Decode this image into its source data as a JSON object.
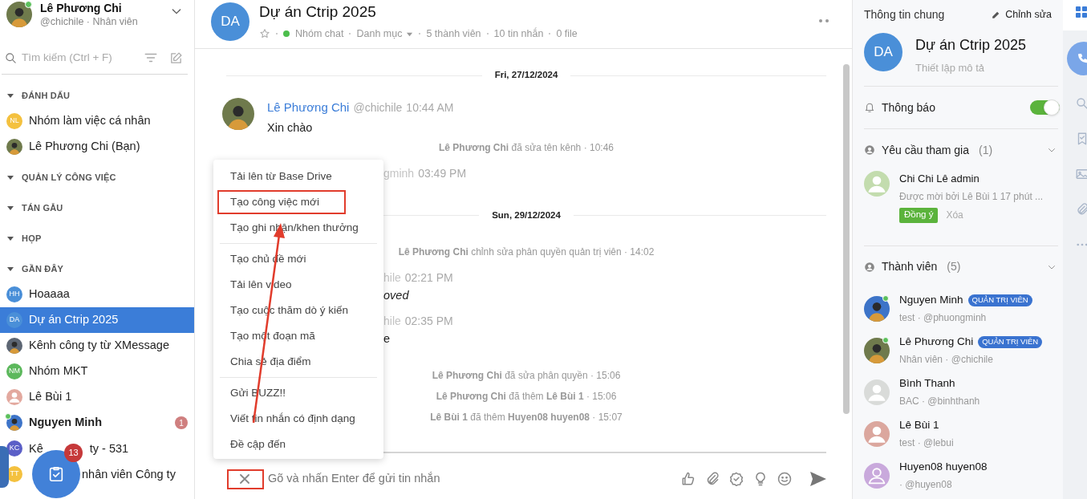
{
  "user": {
    "name": "Lê Phương Chi",
    "subtitle": "@chichile · Nhân viên",
    "online": true
  },
  "search": {
    "placeholder": "Tìm kiếm (Ctrl + F)"
  },
  "sections": [
    {
      "title": "ĐÁNH DẤU",
      "items": [
        {
          "label": "Nhóm làm việc cá nhân",
          "avatar": {
            "kind": "initials",
            "initials": "NL",
            "color": "#f4c13f"
          },
          "selected": false,
          "online": false,
          "unread": false
        },
        {
          "label": "Lê Phương Chi (Bạn)",
          "avatar": {
            "kind": "photo",
            "color": "#6f7a4c"
          },
          "selected": false,
          "online": false,
          "unread": false
        }
      ]
    },
    {
      "title": "QUẢN LÝ CÔNG VIỆC"
    },
    {
      "title": "TÁN GẪU"
    },
    {
      "title": "HỌP"
    },
    {
      "title": "GẦN ĐÂY",
      "items": [
        {
          "label": "Hoaaaa",
          "avatar": {
            "kind": "initials",
            "initials": "HH",
            "color": "#4a8fd8"
          },
          "selected": false,
          "online": false,
          "unread": false
        },
        {
          "label": "Dự án Ctrip 2025",
          "avatar": {
            "kind": "initials",
            "initials": "DA",
            "color": "#4a8fd8"
          },
          "selected": true,
          "online": false,
          "unread": false
        },
        {
          "label": "Kênh công ty từ XMessage",
          "avatar": {
            "kind": "photo",
            "color": "#5d6673"
          },
          "selected": false,
          "online": false,
          "unread": false
        },
        {
          "label": "Nhóm MKT",
          "avatar": {
            "kind": "initials",
            "initials": "NM",
            "color": "#5cb85c"
          },
          "selected": false,
          "online": false,
          "unread": false
        },
        {
          "label": "Lê Bùi 1",
          "avatar": {
            "kind": "person",
            "color": "#e3a99f"
          },
          "selected": false,
          "online": false,
          "unread": false
        },
        {
          "label": "Nguyen Minh",
          "avatar": {
            "kind": "photo",
            "color": "#3d74c8"
          },
          "selected": false,
          "online": true,
          "unread": true,
          "badge": "1"
        },
        {
          "label": "Kê",
          "label_tail": "ty - 531",
          "avatar": {
            "kind": "initials",
            "initials": "KC",
            "color": "#5b5fc7"
          },
          "selected": false,
          "online": false,
          "unread": false
        },
        {
          "label": "nhân viên Công ty",
          "kind": "covered",
          "avatar": {
            "kind": "initials",
            "initials": "TT",
            "color": "#f4c13f"
          },
          "selected": false,
          "online": false,
          "unread": false
        }
      ]
    }
  ],
  "fab": {
    "badge": "13"
  },
  "channel": {
    "initials": "DA",
    "title": "Dự án Ctrip 2025",
    "starred": false,
    "type": "Nhóm chat",
    "category": "Danh mục",
    "members": "5 thành viên",
    "messages": "10 tin nhắn",
    "files": "0 file"
  },
  "timeline": [
    {
      "kind": "date",
      "text": "Fri, 27/12/2024"
    },
    {
      "kind": "message",
      "author": "Lê Phương Chi",
      "handle": "@chichile",
      "time": "10:44 AM",
      "text": "Xin chào"
    },
    {
      "kind": "event",
      "text": "**Lê Phương Chi** đã sửa tên kênh · 10:46"
    },
    {
      "kind": "fragment",
      "handle": "gminh",
      "time": "03:49 PM"
    },
    {
      "kind": "date",
      "text": "Sun, 29/12/2024"
    },
    {
      "kind": "event",
      "text": "**Lê Phương Chi** chỉnh sửa phân quyền quản trị viên · 14:02"
    },
    {
      "kind": "fragment",
      "handle": "hile",
      "time": "02:21 PM",
      "text": "oved",
      "italic": true
    },
    {
      "kind": "fragment",
      "handle": "hile",
      "time": "02:35 PM",
      "text": "e",
      "italic": false
    },
    {
      "kind": "event",
      "text": "**Lê Phương Chi** đã sửa phân quyền · 15:06"
    },
    {
      "kind": "event",
      "text": "**Lê Phương Chi** đã thêm **Lê Bùi 1** · 15:06"
    },
    {
      "kind": "event",
      "text": "**Lê Bùi 1** đã thêm **Huyen08 huyen08** · 15:07"
    }
  ],
  "menu": [
    [
      {
        "label": "Tải lên từ Base Drive",
        "highlighted": false
      },
      {
        "label": "Tạo công việc mới",
        "highlighted": true
      },
      {
        "label": "Tạo ghi nhận/khen thưởng",
        "highlighted": false
      }
    ],
    [
      {
        "label": "Tạo chủ đề mới",
        "highlighted": false
      },
      {
        "label": "Tải lên video",
        "highlighted": false
      },
      {
        "label": "Tạo cuộc thăm dò ý kiến",
        "highlighted": false
      },
      {
        "label": "Tạo một đoạn mã",
        "highlighted": false
      },
      {
        "label": "Chia sẻ địa điểm",
        "highlighted": false
      }
    ],
    [
      {
        "label": "Gửi BUZZ!!",
        "highlighted": false
      },
      {
        "label": "Viết tin nhắn có định dạng",
        "highlighted": false
      },
      {
        "label": "Đề cập đến",
        "highlighted": false
      }
    ]
  ],
  "composer": {
    "placeholder": "Gõ và nhấn Enter để gửi tin nhắn",
    "close_highlighted": true
  },
  "info": {
    "title": "Thông tin chung",
    "edit": "Chỉnh sửa",
    "initials": "DA",
    "name": "Dự án Ctrip 2025",
    "description_placeholder": "Thiết lập mô tả",
    "notifications": {
      "label": "Thông báo",
      "on": true
    },
    "requests": {
      "title": "Yêu cầu tham gia",
      "count": "(1)",
      "items": [
        {
          "name": "Chi Chi Lê admin",
          "subtitle": "Được mời bởi Lê Bùi 1 17 phút ...",
          "accept": "Đồng ý",
          "reject": "Xóa",
          "avatar": {
            "kind": "person",
            "color": "#c3dcae"
          }
        }
      ]
    },
    "members": {
      "title": "Thành viên",
      "count": "(5)",
      "items": [
        {
          "name": "Nguyen Minh",
          "role": "QUẢN TRỊ VIÊN",
          "subtitle": "test · @phuongminh",
          "online": true,
          "avatar": {
            "kind": "photo",
            "color": "#3d74c8"
          }
        },
        {
          "name": "Lê Phương Chi",
          "role": "QUẢN TRỊ VIÊN",
          "subtitle": "Nhân viên · @chichile",
          "online": true,
          "avatar": {
            "kind": "photo",
            "color": "#6f7a4c"
          }
        },
        {
          "name": "Bình Thanh",
          "subtitle": "BAC · @binhthanh",
          "online": false,
          "avatar": {
            "kind": "person",
            "color": "#d9dbd9"
          }
        },
        {
          "name": "Lê Bùi 1",
          "subtitle": "test · @lebui",
          "online": false,
          "avatar": {
            "kind": "person",
            "color": "#dba79e"
          }
        },
        {
          "name": "Huyen08 huyen08",
          "subtitle": "· @huyen08",
          "online": false,
          "avatar": {
            "kind": "outline",
            "color": "#c9a9dc"
          }
        }
      ]
    }
  }
}
